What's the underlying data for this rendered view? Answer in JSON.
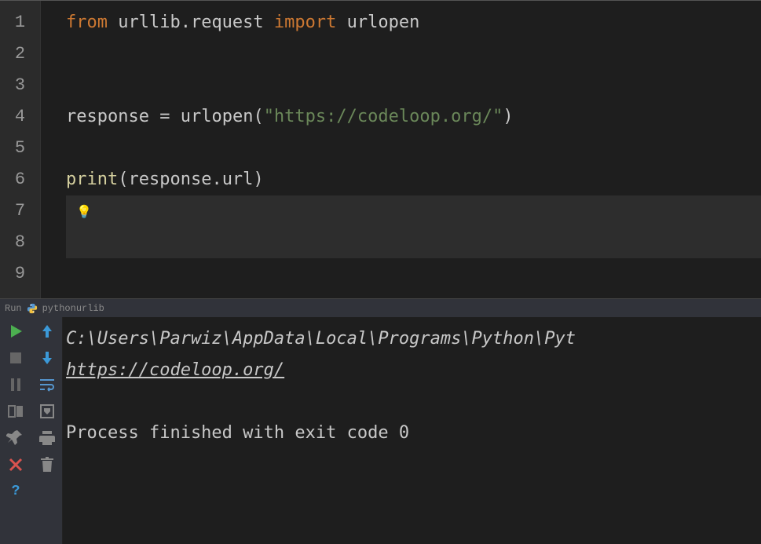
{
  "editor": {
    "lines": [
      "1",
      "2",
      "3",
      "4",
      "5",
      "6",
      "7",
      "8",
      "9"
    ],
    "code": {
      "l1_from": "from",
      "l1_mod": "urllib.request",
      "l1_import": "import",
      "l1_name": "urlopen",
      "l4_var": "response",
      "l4_eq": " = ",
      "l4_fn": "urlopen",
      "l4_open": "(",
      "l4_str": "\"https://codeloop.org/\"",
      "l4_close": ")",
      "l6_print": "print",
      "l6_open": "(",
      "l6_arg": "response.url",
      "l6_close": ")",
      "bulb": "💡"
    }
  },
  "run": {
    "label": "Run",
    "config": "pythonurlib"
  },
  "console": {
    "path": "C:\\Users\\Parwiz\\AppData\\Local\\Programs\\Python\\Pyt",
    "url": "https://codeloop.org/",
    "result": "Process finished with exit code 0"
  }
}
